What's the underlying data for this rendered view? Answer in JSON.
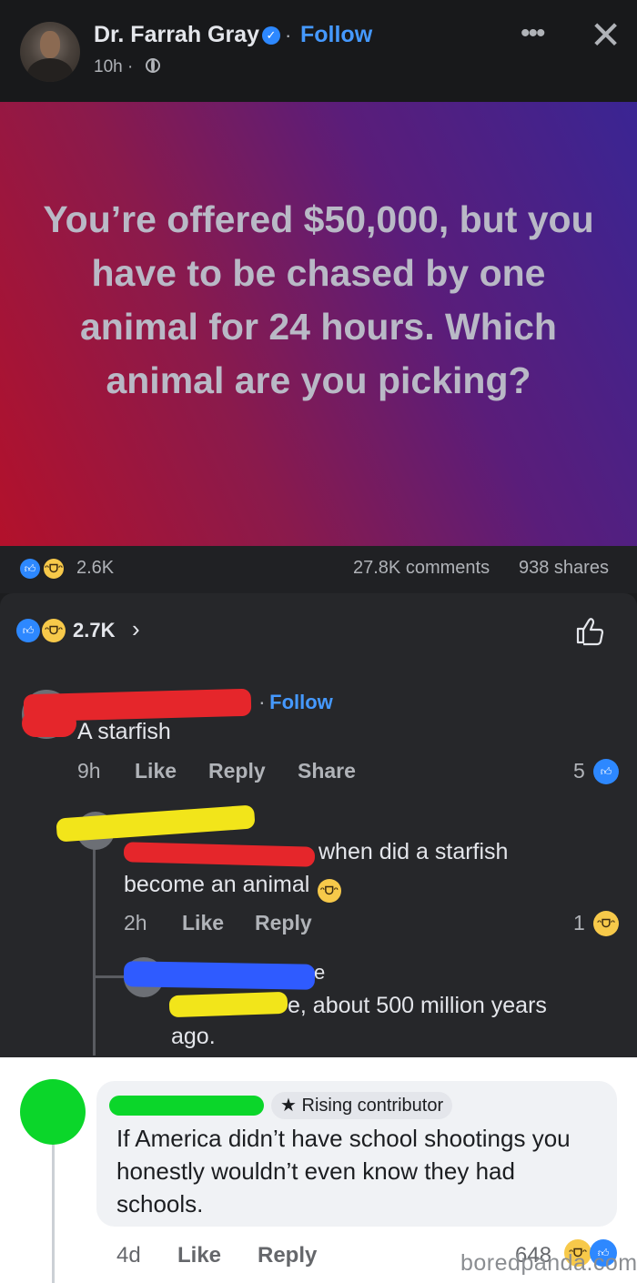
{
  "post": {
    "author_name": "Dr. Farrah Gray",
    "follow_label": "Follow",
    "time": "10h",
    "separator": "·",
    "banner_text": "You’re offered $50,000, but you have to be chased by one animal for 24 hours. Which animal are you picking?",
    "reaction_count": "2.6K",
    "comments_count": "27.8K comments",
    "shares_count": "938 shares"
  },
  "panel": {
    "reaction_count": "2.7K",
    "chevron": "›"
  },
  "comments": [
    {
      "follow_label": "Follow",
      "text": "A starfish",
      "time": "9h",
      "like_label": "Like",
      "reply_label": "Reply",
      "share_label": "Share",
      "reaction_count": "5"
    },
    {
      "text_line1": "when did a starfish",
      "text_line2": "become an animal",
      "time": "2h",
      "like_label": "Like",
      "reply_label": "Reply",
      "reaction_count": "1"
    },
    {
      "name_fragment": "e",
      "text_line1": "e, about 500 million years",
      "text_line2": "ago."
    }
  ],
  "bottom_comment": {
    "badge": "Rising contributor",
    "text": "If America didn’t have school shootings you honestly wouldn’t even know they had schools.",
    "time": "4d",
    "like_label": "Like",
    "reply_label": "Reply",
    "reaction_count": "648"
  },
  "watermark": "boredpanda.com",
  "icons": {
    "verified": "verified-badge-icon",
    "globe": "globe-icon",
    "more": "more-icon",
    "close": "close-icon",
    "like": "like-reaction-icon",
    "haha": "haha-reaction-icon",
    "thumbs_up": "thumbs-up-icon",
    "star": "star-icon"
  },
  "colors": {
    "accent_blue": "#4599ff",
    "dark_bg": "#26272a",
    "banner_start": "#b3112b",
    "banner_end": "#3a2593"
  }
}
